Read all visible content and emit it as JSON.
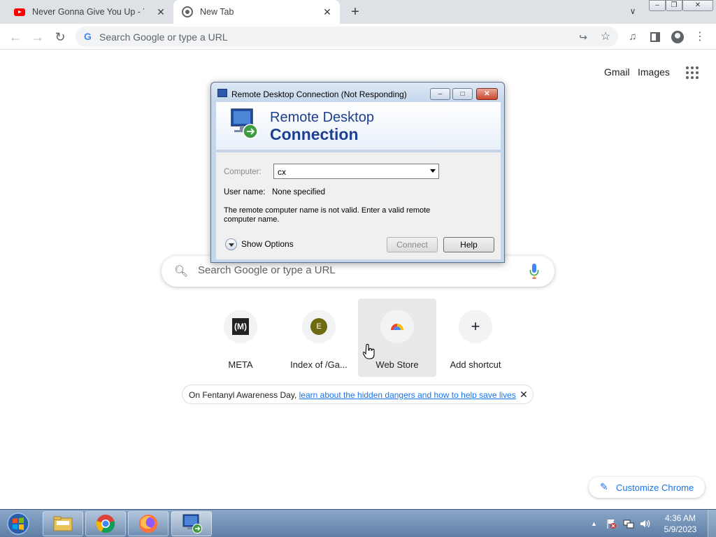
{
  "browser": {
    "tabs": [
      {
        "title": "Never Gonna Give You Up - YouT",
        "icon": "youtube-icon",
        "close": "✕"
      },
      {
        "title": "New Tab",
        "icon": "chrome-icon",
        "close": "✕"
      }
    ],
    "new_tab": "+",
    "omnibox": {
      "placeholder": "Search Google or type a URL"
    }
  },
  "ntp": {
    "gmail": "Gmail",
    "images": "Images",
    "search_placeholder": "Search Google or type a URL",
    "shortcuts": [
      {
        "label": "META",
        "favicon_text": "(M)"
      },
      {
        "label": "Index of /Ga...",
        "favicon_text": "E"
      },
      {
        "label": "Web Store"
      },
      {
        "label": "Add shortcut",
        "favicon_text": "+"
      }
    ],
    "promo": {
      "prefix": "On Fentanyl Awareness Day, ",
      "link": "learn about the hidden dangers and how to help save lives",
      "close": "✕"
    },
    "customize": "Customize Chrome"
  },
  "rdp": {
    "title": "Remote Desktop Connection (Not Responding)",
    "heading_line1": "Remote Desktop",
    "heading_line2": "Connection",
    "computer_label": "Computer:",
    "computer_value": "cx",
    "user_label": "User name:",
    "user_value": "None specified",
    "message": "The remote computer name is not valid. Enter a valid remote computer name.",
    "show_options": "Show Options",
    "connect": "Connect",
    "help": "Help"
  },
  "taskbar": {
    "time": "4:36 AM",
    "date": "5/9/2023"
  },
  "colors": {
    "accent": "#1a73e8",
    "rdp_heading": "#1e3f8f",
    "taskbar": "#6f8fb5"
  }
}
